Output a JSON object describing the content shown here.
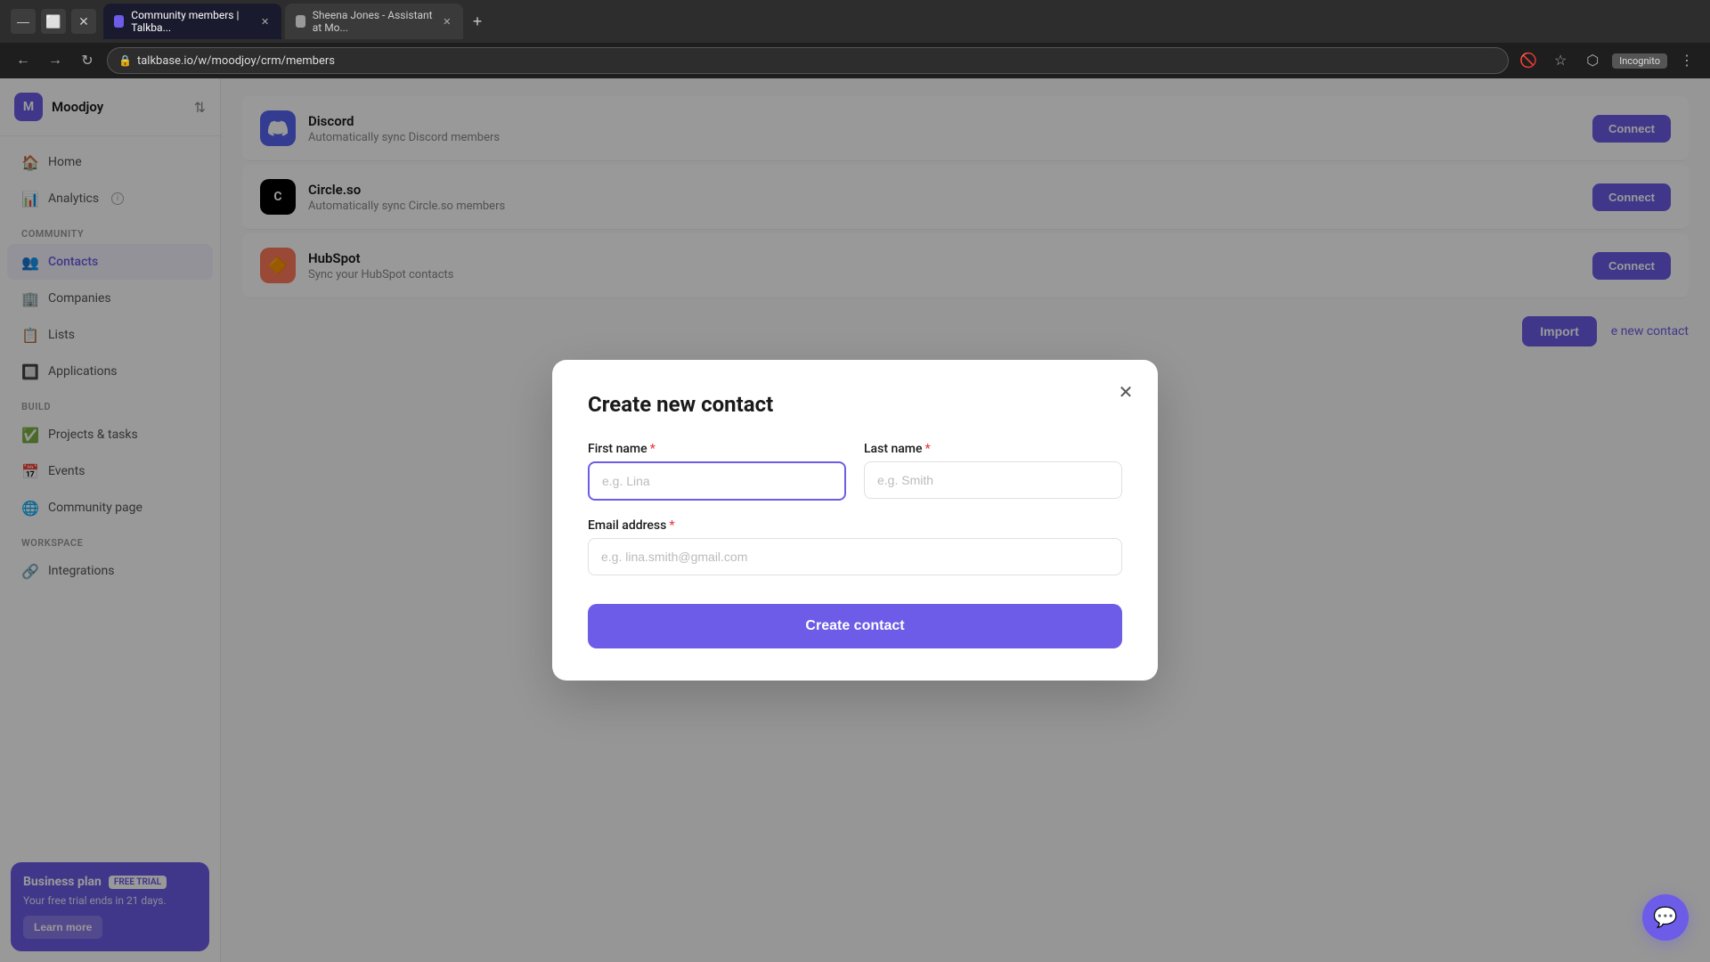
{
  "browser": {
    "tabs": [
      {
        "id": "tab1",
        "title": "Community members | Talkba...",
        "active": true,
        "favicon": "T"
      },
      {
        "id": "tab2",
        "title": "Sheena Jones - Assistant at Mo...",
        "active": false,
        "favicon": "S"
      }
    ],
    "address": "talkbase.io/w/moodjoy/crm/members",
    "incognito_label": "Incognito"
  },
  "sidebar": {
    "workspace": {
      "initial": "M",
      "name": "Moodjoy"
    },
    "nav_items": [
      {
        "id": "home",
        "label": "Home",
        "icon": "🏠"
      },
      {
        "id": "analytics",
        "label": "Analytics",
        "icon": "📊",
        "has_info": true
      }
    ],
    "community_section": "COMMUNITY",
    "community_items": [
      {
        "id": "contacts",
        "label": "Contacts",
        "icon": "👥",
        "active": true
      },
      {
        "id": "companies",
        "label": "Companies",
        "icon": "🏢"
      },
      {
        "id": "lists",
        "label": "Lists",
        "icon": "📋"
      },
      {
        "id": "applications",
        "label": "Applications",
        "icon": "🔲"
      }
    ],
    "build_section": "BUILD",
    "build_items": [
      {
        "id": "projects",
        "label": "Projects & tasks",
        "icon": "✅"
      },
      {
        "id": "events",
        "label": "Events",
        "icon": "📅"
      },
      {
        "id": "community-page",
        "label": "Community page",
        "icon": "🌐"
      }
    ],
    "workspace_section": "WORKSPACE",
    "workspace_items": [
      {
        "id": "integrations",
        "label": "Integrations",
        "icon": "🔗"
      }
    ],
    "plan_banner": {
      "plan_name": "Business plan",
      "badge": "FREE TRIAL",
      "description": "Your free trial ends in 21 days.",
      "cta": "Learn more"
    }
  },
  "integrations": [
    {
      "id": "discord",
      "name": "Discord",
      "description": "Automatically sync Discord members",
      "icon": "discord",
      "connect_label": "Connect"
    },
    {
      "id": "circle",
      "name": "Circle.so",
      "description": "Automatically sync Circle.so members",
      "icon": "circle",
      "connect_label": "Connect"
    },
    {
      "id": "hubspot",
      "name": "HubSpot",
      "description": "Sync your HubSpot contacts",
      "icon": "hubspot",
      "connect_label": "Connect"
    }
  ],
  "action_buttons": {
    "import_label": "Import",
    "new_contact_label": "e new contact"
  },
  "modal": {
    "title": "Create new contact",
    "first_name_label": "First name",
    "first_name_placeholder": "e.g. Lina",
    "last_name_label": "Last name",
    "last_name_placeholder": "e.g. Smith",
    "email_label": "Email address",
    "email_placeholder": "e.g. lina.smith@gmail.com",
    "create_button_label": "Create contact",
    "required_indicator": "*"
  }
}
